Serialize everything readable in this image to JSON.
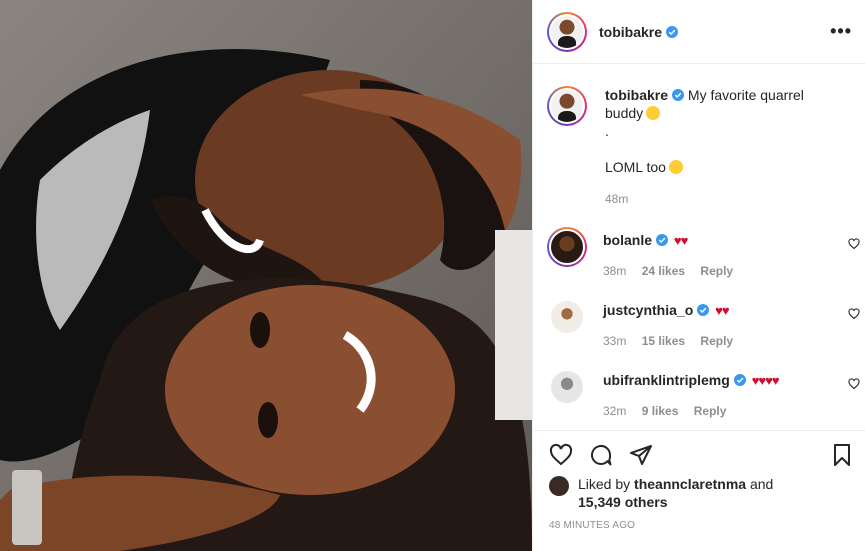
{
  "header": {
    "username": "tobibakre",
    "more_label": "•••"
  },
  "caption": {
    "username": "tobibakre",
    "text_line1": "My favorite quarrel",
    "text_line2": "buddy",
    "dot": ".",
    "text_line3": "LOML too",
    "time": "48m"
  },
  "comments": [
    {
      "username": "bolanle",
      "hearts": "♥♥",
      "time": "38m",
      "likes": "24 likes",
      "reply": "Reply"
    },
    {
      "username": "justcynthia_o",
      "hearts": "♥♥",
      "time": "33m",
      "likes": "15 likes",
      "reply": "Reply"
    },
    {
      "username": "ubifranklintriplemg",
      "hearts": "♥♥♥♥",
      "time": "32m",
      "likes": "9 likes",
      "reply": "Reply"
    }
  ],
  "likes": {
    "prefix": "Liked by",
    "user": "theannclaretnma",
    "and": "and",
    "count": "15,349 others"
  },
  "timestamp": "48 MINUTES AGO",
  "colors": {
    "verified": "#3897f0",
    "heart": "#d10d2f",
    "muted": "#8e8e8e",
    "text": "#262626",
    "border": "#efefef"
  },
  "icons": [
    "verified-icon",
    "more-icon",
    "like-icon",
    "comment-icon",
    "share-icon",
    "save-icon",
    "heart-small-icon",
    "smile-emoji",
    "kiss-emoji"
  ]
}
